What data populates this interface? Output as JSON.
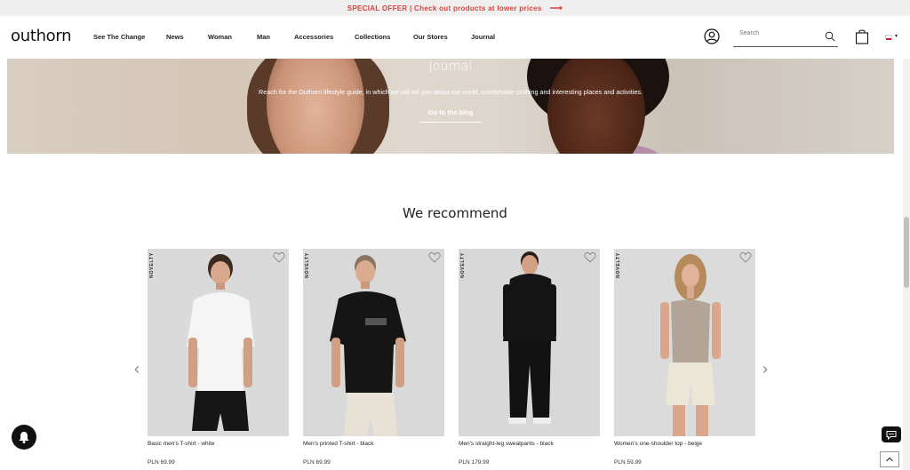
{
  "promo": {
    "text": "SPECIAL OFFER | Check out products at lower prices",
    "arrow": "⟶"
  },
  "header": {
    "logo": "outhorn",
    "nav": [
      "See The Change",
      "News",
      "Woman",
      "Man",
      "Accessories",
      "Collections",
      "Our Stores",
      "Journal"
    ],
    "search_placeholder": "Search",
    "language_chevron": "▾"
  },
  "hero": {
    "title": "Journal",
    "subtitle": "Reach for the Outhorn lifestyle guide, in which we will tell you about our world, comfortable clothing and interesting places and activities.",
    "cta": "Go to the blog"
  },
  "recommend": {
    "title": "We recommend",
    "prev": "‹",
    "next": "›",
    "products": [
      {
        "badge": "NOVELTY",
        "name": "Basic men's T-shirt - white",
        "price": "PLN 69.99"
      },
      {
        "badge": "NOVELTY",
        "name": "Men's printed T-shirt - black",
        "price": "PLN 69.99"
      },
      {
        "badge": "NOVELTY",
        "name": "Men's straight-leg sweatpants - black",
        "price": "PLN 179.99"
      },
      {
        "badge": "NOVELTY",
        "name": "Women's one-shoulder top - beige",
        "price": "PLN 59.99"
      }
    ]
  },
  "colors": {
    "promo_text": "#d9423a",
    "dark": "#111111"
  }
}
